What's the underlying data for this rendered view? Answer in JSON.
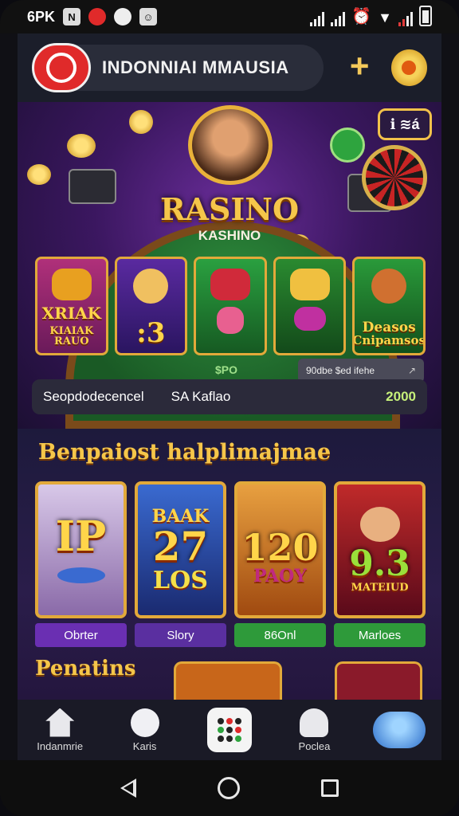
{
  "status": {
    "left_text": "6PK",
    "icons": [
      "nfc-icon",
      "record-icon",
      "app-icon",
      "people-icon"
    ],
    "right_icons": [
      "signal-icon",
      "signal-icon",
      "alarm-icon",
      "wifi-icon",
      "signal-icon",
      "battery-icon"
    ]
  },
  "header": {
    "brand": "INDONNIAI MMAUSIA",
    "plus_label": "+"
  },
  "hero": {
    "title": "RASINO",
    "subtitle": "KASHINO",
    "badge": "ℹ ≋á",
    "games": [
      {
        "text": "XRIAK",
        "sub": "KIAIAK RAUO"
      },
      {
        "text": ":3",
        "sub": ""
      },
      {
        "text": "",
        "sub": ""
      },
      {
        "text": "",
        "sub": ""
      },
      {
        "text": "Deasos",
        "sub": "Cnipamsos"
      }
    ],
    "price": "$PO",
    "search_text": "90dbe $ed ifehe",
    "search_arrow": "↗"
  },
  "infobar": {
    "label": "Seopdodecencel",
    "mid": "SA Kaflao",
    "amount": "2000"
  },
  "section2": {
    "title": "Benpaiost halplimajmae",
    "slots": [
      {
        "big": "IP",
        "small": "",
        "button": "Obrter",
        "button_color": "#6a2fb2"
      },
      {
        "big": "27",
        "small": "LOS",
        "top": "BAAK",
        "button": "Slory",
        "button_color": "#5a2fa0"
      },
      {
        "big": "120",
        "small": "PAOY",
        "button": "86Onl",
        "button_color": "#2e9a3a"
      },
      {
        "big": "9.3",
        "small": "MATEIUD",
        "button": "Marloes",
        "button_color": "#2e9a3a"
      }
    ],
    "subtitle": "Penatins"
  },
  "bottom_nav": [
    {
      "icon": "house-icon",
      "label": "Indanmrie"
    },
    {
      "icon": "flower-icon",
      "label": "Karis"
    },
    {
      "icon": "apps-grid-icon",
      "label": ""
    },
    {
      "icon": "cap-icon",
      "label": "Poclea"
    },
    {
      "icon": "mascot-icon",
      "label": ""
    }
  ],
  "colors": {
    "accent_gold": "#f5c64a",
    "brand_red": "#e02a2a",
    "amount_green": "#c6f07a"
  }
}
